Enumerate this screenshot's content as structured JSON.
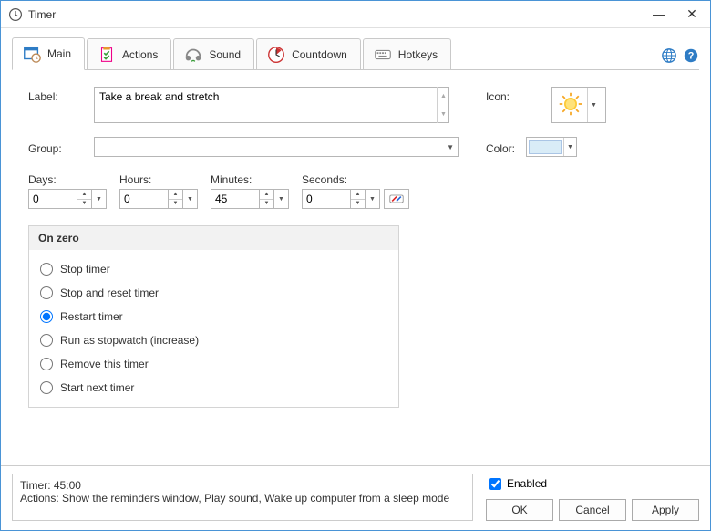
{
  "window": {
    "title": "Timer"
  },
  "tabs": {
    "main": "Main",
    "actions": "Actions",
    "sound": "Sound",
    "countdown": "Countdown",
    "hotkeys": "Hotkeys"
  },
  "labels": {
    "label_field": "Label:",
    "group_field": "Group:",
    "icon_field": "Icon:",
    "color_field": "Color:",
    "days": "Days:",
    "hours": "Hours:",
    "minutes": "Minutes:",
    "seconds": "Seconds:"
  },
  "fields": {
    "label_value": "Take a break and stretch",
    "group_value": "",
    "days": "0",
    "hours": "0",
    "minutes": "45",
    "seconds": "0"
  },
  "colors": {
    "color_swatch": "#d9ecf7"
  },
  "onzero": {
    "heading": "On zero",
    "stop": "Stop timer",
    "stopreset": "Stop and reset timer",
    "restart": "Restart timer",
    "stopwatch": "Run as stopwatch (increase)",
    "remove": "Remove this timer",
    "next": "Start next timer",
    "selected": "restart"
  },
  "footer": {
    "summary_line1": "Timer: 45:00",
    "summary_line2": "Actions: Show the reminders window, Play sound, Wake up computer from a sleep mode",
    "enabled_label": "Enabled",
    "enabled_checked": true,
    "ok": "OK",
    "cancel": "Cancel",
    "apply": "Apply"
  }
}
